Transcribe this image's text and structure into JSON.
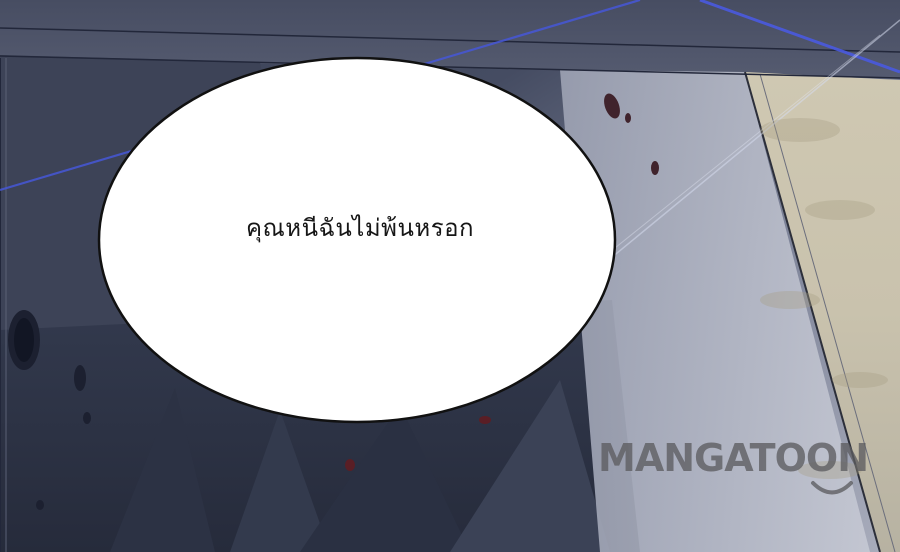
{
  "speech_bubble": {
    "text": "คุณหนีฉันไม่พ้นหรอก"
  },
  "watermark": {
    "text": "MANGATOON",
    "icon": "smile-curve-icon"
  },
  "colors": {
    "bubble_fill": "#ffffff",
    "bubble_outline": "#111111",
    "background_dark": "#2e3448",
    "background_light": "#b8bccb",
    "light_ray": "#4a5ad8",
    "watermark": "#5c5c60"
  }
}
